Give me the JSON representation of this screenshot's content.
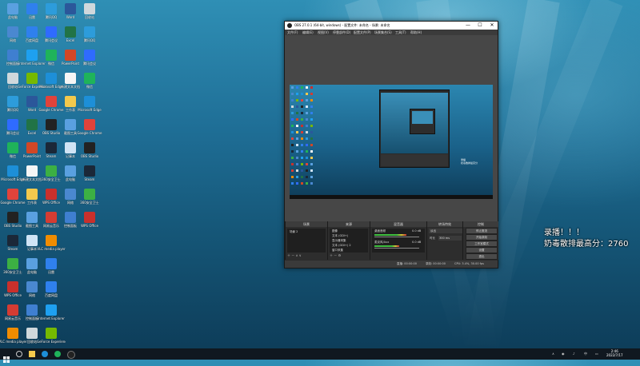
{
  "desktop": {
    "icons": [
      {
        "label": "此电脑",
        "color": "#5aa0e0"
      },
      {
        "label": "网络",
        "color": "#4a88d0"
      },
      {
        "label": "控制面板",
        "color": "#3f7fd0"
      },
      {
        "label": "回收站",
        "color": "#cfd8dc"
      },
      {
        "label": "腾讯QQ",
        "color": "#2d9cdb"
      },
      {
        "label": "腾讯会议",
        "color": "#2f6bff"
      },
      {
        "label": "微信",
        "color": "#1fb35a"
      },
      {
        "label": "Microsoft Edge",
        "color": "#1d8fd8"
      },
      {
        "label": "Google Chrome",
        "color": "#e0433b"
      },
      {
        "label": "OBS Studio",
        "color": "#222222"
      },
      {
        "label": "Steam",
        "color": "#1b2838"
      },
      {
        "label": "360安全卫士",
        "color": "#3cb043"
      },
      {
        "label": "WPS Office",
        "color": "#c9302c"
      },
      {
        "label": "网易云音乐",
        "color": "#d43c33"
      },
      {
        "label": "VLC media player",
        "color": "#f08c00"
      },
      {
        "label": "迅雷",
        "color": "#2f80ed"
      },
      {
        "label": "百度网盘",
        "color": "#2f80ed"
      },
      {
        "label": "Internet Explorer",
        "color": "#1ea0f0"
      },
      {
        "label": "GeForce Experience",
        "color": "#76b900"
      },
      {
        "label": "Word",
        "color": "#2b579a"
      },
      {
        "label": "Excel",
        "color": "#217346"
      },
      {
        "label": "PowerPoint",
        "color": "#d24726"
      },
      {
        "label": "新建文本文档",
        "color": "#f5f5f5"
      },
      {
        "label": "工作表",
        "color": "#f3c94d"
      },
      {
        "label": "截图工具",
        "color": "#5aa0e0"
      },
      {
        "label": "记事本",
        "color": "#d0e4f5"
      }
    ]
  },
  "obs": {
    "title": "OBS 27.0.1 (64-bit, windows) - 配置文件: 未命名 - 场景: 未命名",
    "minimize": "—",
    "maximize": "☐",
    "close": "✕",
    "menu": [
      "文件(F)",
      "编辑(E)",
      "视图(V)",
      "停靠部件(D)",
      "配置文件(P)",
      "场景集合(S)",
      "工具(T)",
      "帮助(H)"
    ],
    "canvas_text": [
      "录播",
      "奶毒散排最高分"
    ],
    "docks": {
      "scenes": {
        "title": "场景",
        "items": [
          "场景 2"
        ]
      },
      "sources": {
        "title": "来源",
        "items": [
          "图像",
          "文本 (GDI+)",
          "显示器采集",
          "文本 (GDI+) 2",
          "窗口采集"
        ]
      },
      "mixer": {
        "title": "混音器",
        "channels": [
          {
            "name": "桌面音频",
            "level": "0.0 dB",
            "fill": 0.72
          },
          {
            "name": "麦克风/Aux",
            "level": "0.0 dB",
            "fill": 0.55
          }
        ]
      },
      "transitions": {
        "title": "转场特效",
        "type": "淡出",
        "duration_label": "时长",
        "duration": "300 ms"
      },
      "controls": {
        "title": "控制",
        "buttons": [
          "停止推流",
          "开始录制",
          "工作室模式",
          "设置",
          "退出"
        ]
      }
    },
    "status": {
      "live": "直播: 00:00:00",
      "rec": "录制: 00:00:00",
      "cpu": "CPU: 3.4%, 30.00 fps"
    }
  },
  "overlay": {
    "line1": "录播！！！",
    "line2": "奶毒散排最高分：2760"
  },
  "taskbar": {
    "time": "2:46",
    "date": "2022/7/17"
  }
}
